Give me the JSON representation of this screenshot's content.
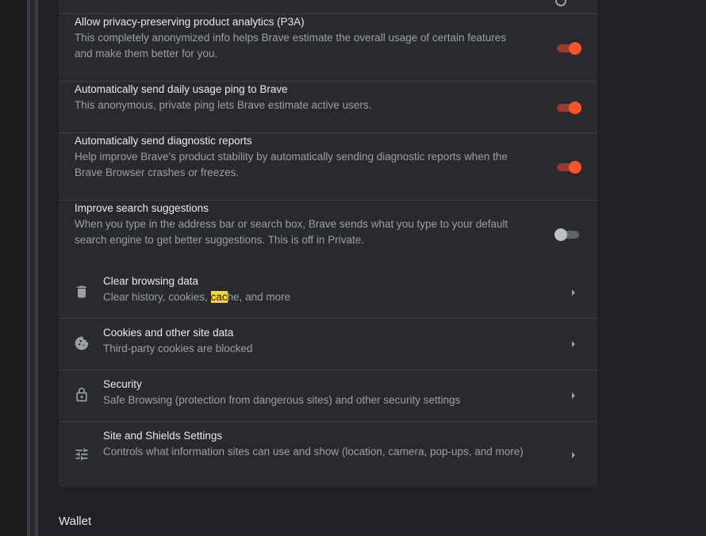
{
  "rows": [
    {
      "title": "Allow privacy-preserving product analytics (P3A)",
      "desc": "This completely anonymized info helps Brave estimate the overall usage of certain features and make them better for you.",
      "toggle": "on"
    },
    {
      "title": "Automatically send daily usage ping to Brave",
      "desc": "This anonymous, private ping lets Brave estimate active users.",
      "toggle": "on"
    },
    {
      "title": "Automatically send diagnostic reports",
      "desc": "Help improve Brave's product stability by automatically sending diagnostic reports when the Brave Browser crashes or freezes.",
      "toggle": "on"
    },
    {
      "title": "Improve search suggestions",
      "desc": "When you type in the address bar or search box, Brave sends what you type to your default search engine to get better suggestions. This is off in Private.",
      "toggle": "off"
    }
  ],
  "links": [
    {
      "title": "Clear browsing data",
      "desc_before": "Clear history, cookies, ",
      "desc_highlight": "cac",
      "desc_after": "he, and more",
      "icon": "trash-icon"
    },
    {
      "title": "Cookies and other site data",
      "desc": "Third-party cookies are blocked",
      "icon": "cookie-icon"
    },
    {
      "title": "Security",
      "desc": "Safe Browsing (protection from dangerous sites) and other security settings",
      "icon": "lock-icon"
    },
    {
      "title": "Site and Shields Settings",
      "desc": "Controls what information sites can use and show (location, camera, pop-ups, and more)",
      "icon": "sliders-icon"
    }
  ],
  "next_section": {
    "title": "Wallet"
  },
  "colors": {
    "accent": "#fb542b",
    "highlight": "#fdd835",
    "card": "#292a2d",
    "page": "#202124"
  }
}
